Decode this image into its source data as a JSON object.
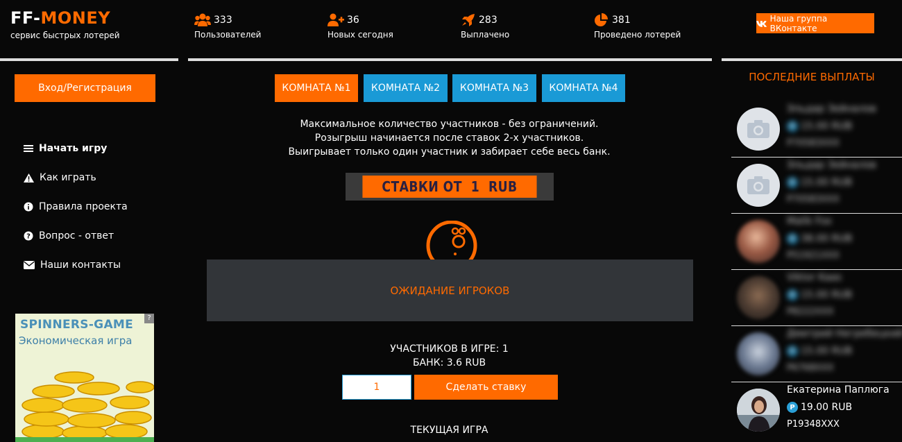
{
  "brand": {
    "logo_part1": "FF-",
    "logo_part2": "MONEY",
    "tagline": "сервис быстрых лотерей"
  },
  "stats": [
    {
      "icon": "users-icon",
      "value": "333",
      "label": "Пользователей"
    },
    {
      "icon": "user-plus-icon",
      "value": "36",
      "label": "Новых сегодня"
    },
    {
      "icon": "rocket-icon",
      "value": "283",
      "label": "Выплачено"
    },
    {
      "icon": "pie-chart-icon",
      "value": "381",
      "label": "Проведено лотерей"
    }
  ],
  "header": {
    "vk_button": "Наша группа ВКонтакте"
  },
  "sidebar": {
    "login_button": "Вход/Регистрация",
    "menu": [
      {
        "icon": "bars-icon",
        "label": "Начать игру"
      },
      {
        "icon": "warning-icon",
        "label": "Как играть"
      },
      {
        "icon": "info-icon",
        "label": "Правила проекта"
      },
      {
        "icon": "question-icon",
        "label": "Вопрос - ответ"
      },
      {
        "icon": "envelope-icon",
        "label": "Наши контакты"
      }
    ],
    "ad": {
      "title": "SPINNERS-GAME",
      "subtitle": "Экономическая игра",
      "badge": "?"
    }
  },
  "rooms": [
    {
      "label": "КОМНАТА №1",
      "active": true
    },
    {
      "label": "КОМНАТА №2",
      "active": false
    },
    {
      "label": "КОМНАТА №3",
      "active": false
    },
    {
      "label": "КОМНАТА №4",
      "active": false
    }
  ],
  "rules": [
    "Максимальное количество участников - без ограничений.",
    "Розыгрыш начинается после ставок 2-х участников.",
    "Выигрывает только один участник и забирает себе весь банк."
  ],
  "stakes_banner": "СТАВКИ ОТ  1  RUB",
  "game": {
    "status": "ОЖИДАНИЕ ИГРОКОВ",
    "participants": "УЧАСТНИКОВ В ИГРЕ: 1",
    "bank": "БАНК: 3.6 RUB",
    "bet_value": "1",
    "bet_button": "Сделать ставку",
    "current_game_title": "ТЕКУЩАЯ ИГРА"
  },
  "payouts": {
    "title": "ПОСЛЕДНИЕ ВЫПЛАТЫ",
    "badge": "P",
    "items": [
      {
        "name": "Эльдар Зейналов",
        "amount": "15.00 RUB",
        "account": "P70583XXX",
        "avatar": "camera-placeholder",
        "blurred": true
      },
      {
        "name": "Эльдар Зейналов",
        "amount": "15.00 RUB",
        "account": "P70583XXX",
        "avatar": "camera-placeholder",
        "blurred": true
      },
      {
        "name": "Malik Fox",
        "amount": "38.00 RUB",
        "account": "P51921XXX",
        "avatar": "photo",
        "blurred": true
      },
      {
        "name": "Viktor Kaas",
        "amount": "15.00 RUB",
        "account": "P8222XXX",
        "avatar": "photo",
        "blurred": true
      },
      {
        "name": "Дмитрий Негребецкий",
        "amount": "15.00 RUB",
        "account": "P6768XXX",
        "avatar": "photo",
        "blurred": true
      },
      {
        "name": "Екатерина Паплюга",
        "amount": "19.00 RUB",
        "account": "P19348XXX",
        "avatar": "photo",
        "blurred": false
      }
    ]
  },
  "colors": {
    "accent": "#ff6a00",
    "room_blue": "#1a9ad6",
    "panel": "#323539",
    "background": "#080808"
  }
}
